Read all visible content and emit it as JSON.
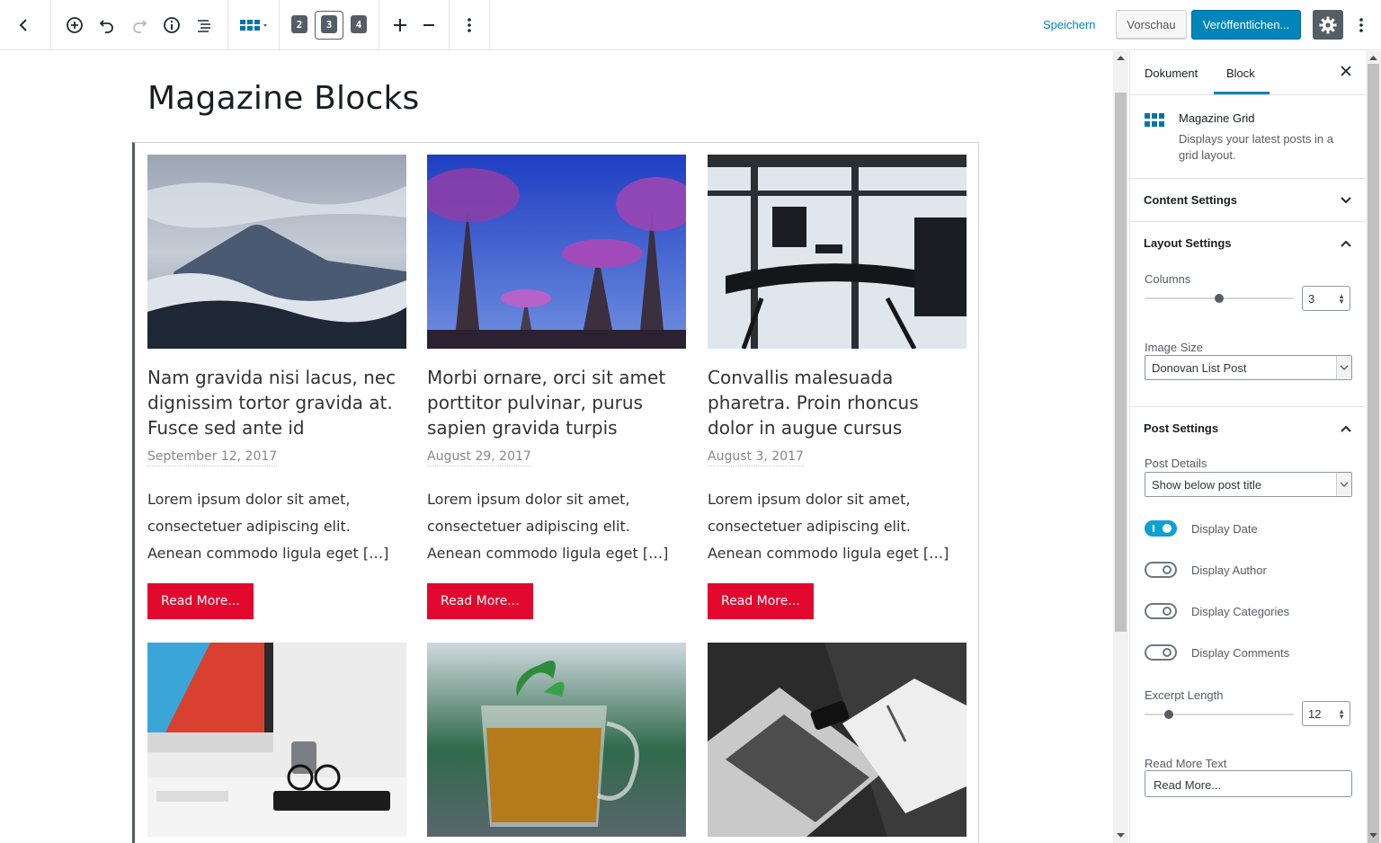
{
  "toolbar": {
    "back_icon": "chevron-left-icon",
    "add_icon": "plus-circle-icon",
    "undo_icon": "undo-icon",
    "redo_icon": "redo-icon",
    "info_icon": "info-icon",
    "outline_icon": "list-icon",
    "block_icon": "grid-icon",
    "columns": [
      "2",
      "3",
      "4"
    ],
    "active_columns": "3",
    "save_label": "Speichern",
    "preview_label": "Vorschau",
    "publish_label": "Veröffentlichen...",
    "settings_icon": "gear-icon",
    "more_icon": "more-vertical-icon",
    "accent_color": "#0085ba"
  },
  "editor": {
    "title": "Magazine Blocks",
    "posts": [
      {
        "title": "Nam gravida nisi lacus, nec dignissim tortor gravida at. Fusce sed ante id",
        "date": "September 12, 2017",
        "excerpt": "Lorem ipsum dolor sit amet, consectetuer adipiscing elit. Aenean commodo ligula eget […]",
        "read_more": "Read More...",
        "image": "mountain-photo"
      },
      {
        "title": "Morbi ornare, orci sit amet porttitor pulvinar, purus sapien gravida turpis",
        "date": "August 29, 2017",
        "excerpt": "Lorem ipsum dolor sit amet, consectetuer adipiscing elit. Aenean commodo ligula eget […]",
        "read_more": "Read More...",
        "image": "supertrees-photo"
      },
      {
        "title": "Convallis malesuada pharetra. Proin rhoncus dolor in augue cursus",
        "date": "August 3, 2017",
        "excerpt": "Lorem ipsum dolor sit amet, consectetuer adipiscing elit. Aenean commodo ligula eget […]",
        "read_more": "Read More...",
        "image": "office-desk-photo"
      },
      {
        "image": "imac-desk-photo"
      },
      {
        "image": "tea-glass-photo"
      },
      {
        "image": "laptop-notebook-photo"
      }
    ],
    "button_color": "#e2072d"
  },
  "sidebar": {
    "tabs": [
      "Dokument",
      "Block"
    ],
    "active_tab": "Block",
    "close_icon": "close-icon",
    "block_card": {
      "icon": "grid-icon",
      "title": "Magazine Grid",
      "description": "Displays your latest posts in a grid layout."
    },
    "content_settings": {
      "label": "Content Settings",
      "expanded": false
    },
    "layout_settings": {
      "label": "Layout Settings",
      "expanded": true,
      "columns_label": "Columns",
      "columns_value": "3",
      "columns_fraction": 0.5,
      "image_size_label": "Image Size",
      "image_size_value": "Donovan List Post"
    },
    "post_settings": {
      "label": "Post Settings",
      "expanded": true,
      "post_details_label": "Post Details",
      "post_details_value": "Show below post title",
      "toggles": [
        {
          "label": "Display Date",
          "on": true
        },
        {
          "label": "Display Author",
          "on": false
        },
        {
          "label": "Display Categories",
          "on": false
        },
        {
          "label": "Display Comments",
          "on": false
        }
      ],
      "excerpt_length_label": "Excerpt Length",
      "excerpt_length_value": "12",
      "excerpt_length_fraction": 0.16,
      "read_more_label": "Read More Text",
      "read_more_value": "Read More..."
    }
  }
}
